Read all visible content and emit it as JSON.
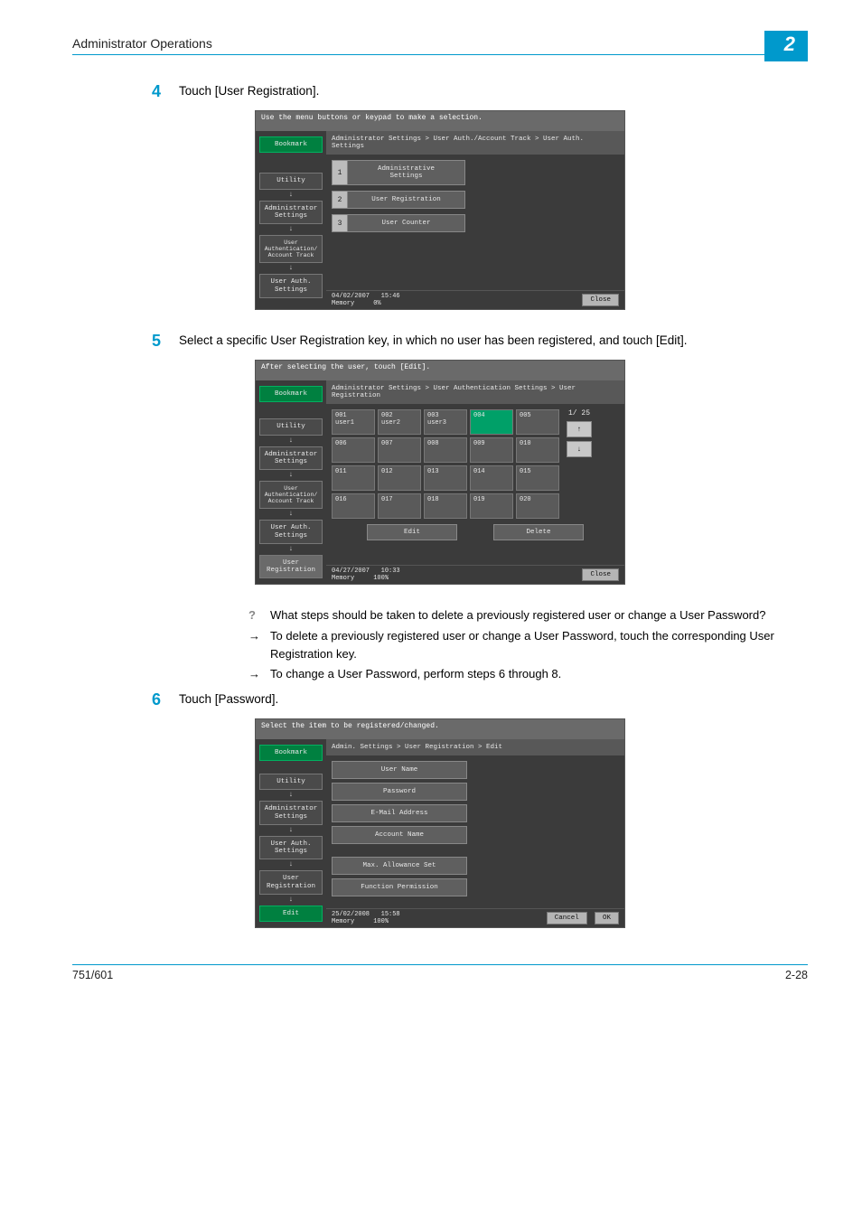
{
  "header": {
    "section_title": "Administrator Operations",
    "chapter_number": "2"
  },
  "steps": {
    "s4": {
      "num": "4",
      "text": "Touch [User Registration]."
    },
    "s5": {
      "num": "5",
      "text": "Select a specific User Registration key, in which no user has been registered, and touch [Edit]."
    },
    "s6": {
      "num": "6",
      "text": "Touch [Password]."
    }
  },
  "qa": {
    "q": "What steps should be taken to delete a previously registered user or change a User Password?",
    "a1": "To delete a previously registered user or change a User Password, touch the corresponding User Registration key.",
    "a2": "To change a User Password, perform steps 6 through 8."
  },
  "panel_common": {
    "bookmark": "Bookmark",
    "utility": "Utility",
    "admin_settings": "Administrator\nSettings",
    "user_auth_track": "User\nAuthentication/\nAccount Track",
    "user_auth_settings": "User Auth.\nSettings",
    "user_registration": "User\nRegistration",
    "edit": "Edit",
    "close": "Close",
    "cancel": "Cancel",
    "ok": "OK",
    "memory": "Memory"
  },
  "screen1": {
    "msg": "Use the menu buttons or keypad to make a selection.",
    "breadcrumb": "Administrator Settings > User Auth./Account Track > User Auth. Settings",
    "items": [
      {
        "n": "1",
        "label": "Administrative\nSettings"
      },
      {
        "n": "2",
        "label": "User Registration"
      },
      {
        "n": "3",
        "label": "User Counter"
      }
    ],
    "date": "04/02/2007",
    "time": "15:46",
    "mem": "0%"
  },
  "screen2": {
    "msg": "After selecting the user, touch [Edit].",
    "breadcrumb": "Administrator Settings > User Authentication Settings > User Registration",
    "page": "1/ 25",
    "cells": [
      "001\nuser1",
      "002\nuser2",
      "003\nuser3",
      "004",
      "005",
      "006",
      "007",
      "008",
      "009",
      "010",
      "011",
      "012",
      "013",
      "014",
      "015",
      "016",
      "017",
      "018",
      "019",
      "020"
    ],
    "selected_index": 3,
    "edit": "Edit",
    "delete": "Delete",
    "date": "04/27/2007",
    "time": "10:33",
    "mem": "100%"
  },
  "screen3": {
    "msg": "Select the item to be registered/changed.",
    "breadcrumb": "Admin. Settings > User Registration > Edit",
    "fields": [
      "User Name",
      "Password",
      "E-Mail Address",
      "Account Name",
      "Max. Allowance Set",
      "Function Permission"
    ],
    "date": "25/02/2008",
    "time": "15:58",
    "mem": "100%"
  },
  "footer": {
    "model": "751/601",
    "page": "2-28"
  }
}
